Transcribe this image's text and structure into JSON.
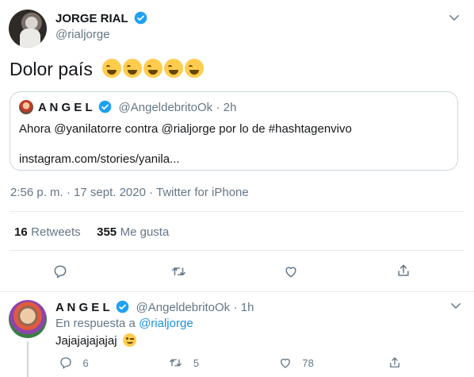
{
  "main_tweet": {
    "author_name": "JORGE RIAL",
    "author_handle": "@rialjorge",
    "text": "Dolor país",
    "emoji_count": 5,
    "quoted": {
      "author_name": "A N G E L",
      "author_handle": "@AngeldebritoOk",
      "time": "· 2h",
      "line1": "Ahora @yanilatorre contra @rialjorge por lo de #hashtagenvivo",
      "line2": "instagram.com/stories/yanila..."
    },
    "timestamp": "2:56 p. m. · 17 sept. 2020 · Twitter for iPhone",
    "retweets_count": "16",
    "retweets_label": "Retweets",
    "likes_count": "355",
    "likes_label": "Me gusta"
  },
  "reply": {
    "author_name": "A N G E L",
    "author_handle": "@AngeldebritoOk",
    "time": "· 1h",
    "in_reply_prefix": "En respuesta a",
    "in_reply_handle": "@rialjorge",
    "text": "Jajajajajajaj",
    "reply_count": "6",
    "retweet_count": "5",
    "like_count": "78"
  },
  "colors": {
    "verified": "#1da1f2",
    "link": "#1b95e0",
    "secondary": "#657786"
  }
}
